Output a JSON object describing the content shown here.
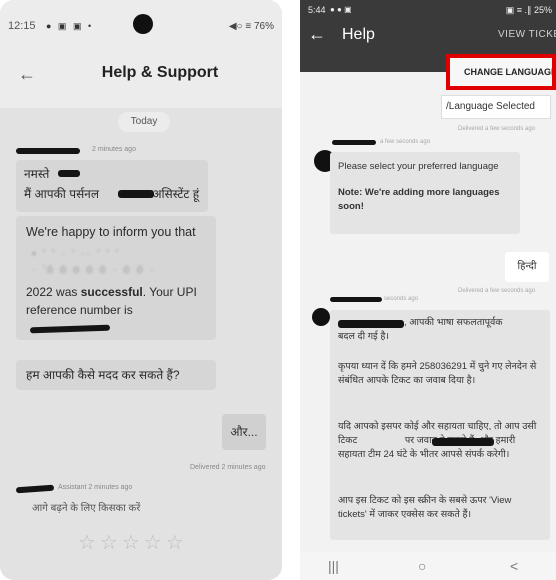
{
  "left_phone": {
    "status_bar": {
      "time": "12:15",
      "icons": "● ▣ ▣ •",
      "right": "◀○ ≡ 76%"
    },
    "header": {
      "back_icon": "←",
      "title": "Help & Support"
    },
    "chat": {
      "date_chip": "Today",
      "msg1_meta": "2 minutes ago",
      "msg1_line1": "नमस्ते",
      "msg1_line2": "मैं आपकी पर्सनल                असिस्टेंट हूं",
      "msg2_line1": "We're happy to inform you that",
      "msg2_line4a": "2022 was ",
      "msg2_bold": "successful",
      "msg2_line4b": ". Your UPI",
      "msg2_line5": "reference number is",
      "msg3": "हम आपकी कैसे मदद कर सकते हैं?",
      "reply": "और...",
      "delivered": "Delivered 2 minutes ago",
      "msg4_meta": "Assistant  2 minutes ago",
      "msg4_partial": "आगे बढ़ने के लिए किसका करें",
      "rating_stars": "☆☆☆☆☆"
    }
  },
  "right_phone": {
    "status_bar": {
      "time": "5:44",
      "icons": "● ● ▣",
      "right": "▣ ≡ .∥ 25%"
    },
    "appbar": {
      "back_icon": "←",
      "title": "Help",
      "view_tickets": "VIEW TICKETS"
    },
    "change_language": "CHANGE LANGUAGE",
    "language_selected": "/Language Selected",
    "chat": {
      "delivered1": "Delivered a few seconds ago",
      "bot_meta": "a few seconds ago",
      "bubble1_line1": "Please select your preferred language",
      "bubble1_note": "Note: We're adding more languages soon!",
      "hindi_reply": "हिन्दी",
      "delivered2": "Delivered a few seconds ago",
      "bot_meta2": "seconds ago",
      "bubble2_p1a": ", आपकी भाषा सफलतापूर्वक",
      "bubble2_p1b": "बदल दी गई है।",
      "bubble2_p2": "कृपया ध्यान दें कि हमने 258036291 में चुने गए लेनदेन से संबंधित आपके टिकट का जवाब दिया है।",
      "bubble2_p3": "यदि आपको इसपर कोई और सहायता चाहिए, तो आप उसी टिकट                  पर जवाब दे सकते हैं, और हमारी सहायता टीम 24 घंटे के भीतर आपसे संपर्क करेगी।",
      "bubble2_p4": "आप इस टिकट को इस स्क्रीन के सबसे ऊपर 'View tickets' में जाकर एक्सेस कर सकते हैं।"
    },
    "navbar": {
      "recents": "|||",
      "home": "○",
      "back": "<"
    }
  }
}
